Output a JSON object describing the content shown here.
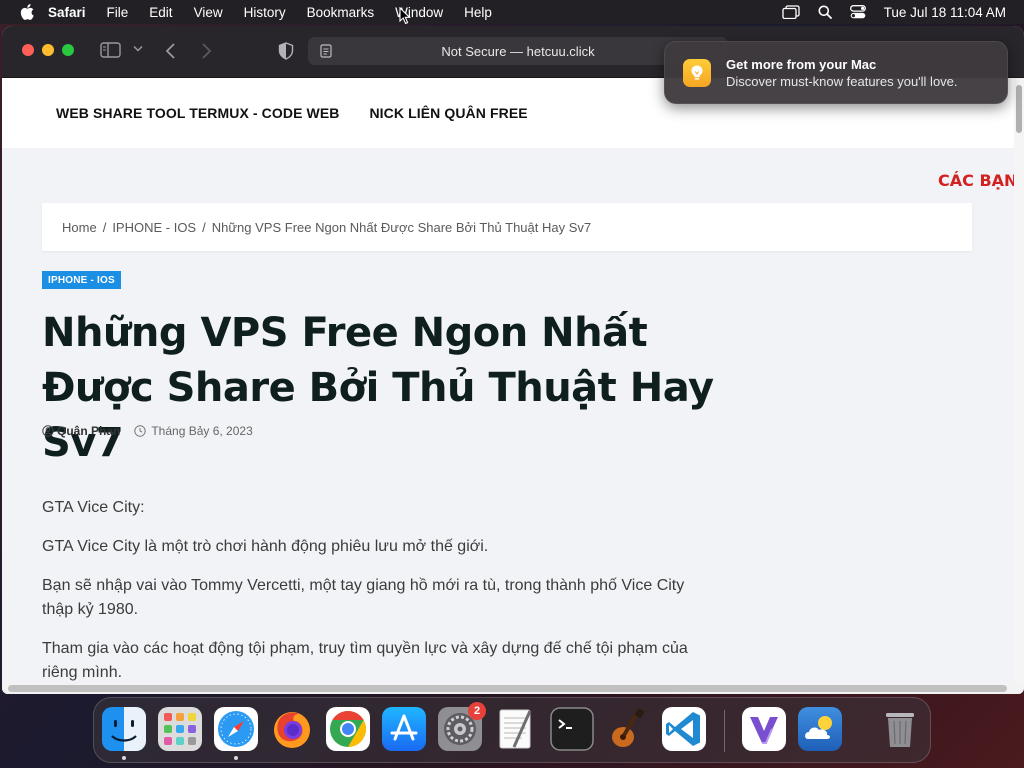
{
  "menubar": {
    "app_name": "Safari",
    "items": [
      "File",
      "Edit",
      "View",
      "History",
      "Bookmarks",
      "Window",
      "Help"
    ],
    "clock": "Tue Jul 18  11:04 AM",
    "icons": [
      "window-switcher-icon",
      "spotlight-search-icon",
      "control-center-icon"
    ]
  },
  "browser": {
    "address": "Not Secure — hetcuu.click"
  },
  "site": {
    "nav": [
      "WEB SHARE TOOL TERMUX - CODE WEB",
      "NICK LIÊN QUÂN FREE"
    ],
    "ticker": "CÁC BẠN V",
    "breadcrumb": [
      "Home",
      "IPHONE - IOS",
      "Những VPS Free Ngon Nhất Được Share Bởi Thủ Thuật Hay Sv7"
    ],
    "category": "IPHONE - IOS",
    "title": "Những VPS Free Ngon Nhất Được Share Bởi Thủ Thuật Hay Sv7",
    "author": "Quân Phan",
    "date": "Tháng Bảy 6, 2023",
    "paragraphs": [
      "GTA Vice City:",
      "GTA Vice City là một trò chơi hành động phiêu lưu mở thế giới.",
      "Bạn sẽ nhập vai vào Tommy Vercetti, một tay giang hồ mới ra tù, trong thành phố Vice City thập kỷ 1980.",
      "Tham gia vào các hoạt động tội phạm, truy tìm quyền lực và xây dựng đế chế tội phạm của riêng mình."
    ]
  },
  "notification": {
    "title": "Get more from your Mac",
    "body": "Discover must-know features you'll love."
  },
  "dock": {
    "apps": [
      "Finder",
      "Launchpad",
      "Safari",
      "Firefox",
      "Chrome",
      "App Store",
      "System Settings",
      "TextEdit",
      "Terminal",
      "GarageBand",
      "Visual Studio Code",
      "Visual Studio",
      "Weather",
      "Trash"
    ],
    "settings_badge": "2"
  }
}
